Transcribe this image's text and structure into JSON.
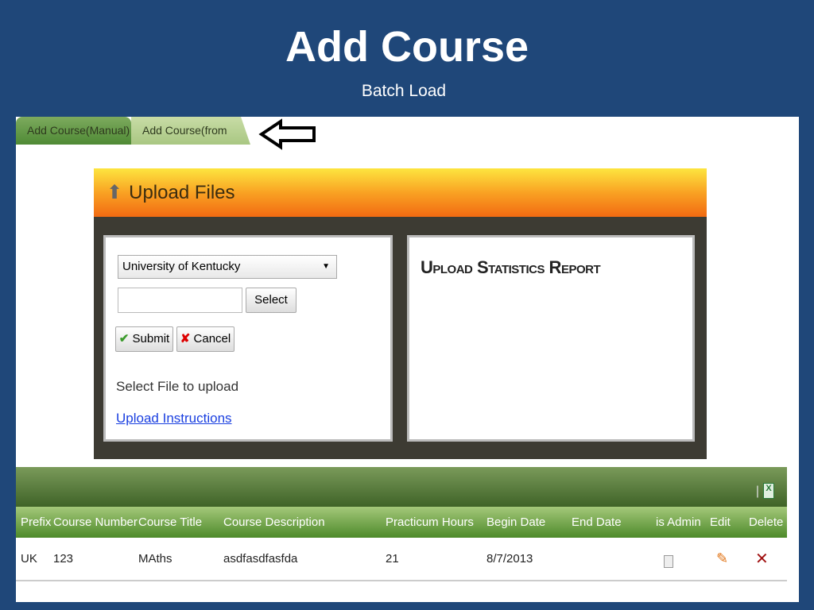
{
  "slide": {
    "title": "Add Course",
    "subtitle": "Batch Load"
  },
  "tabs": [
    {
      "label": "Add Course(Manual)"
    },
    {
      "label": "Add Course(from File)",
      "active": true
    }
  ],
  "upload": {
    "title": "Upload Files",
    "university": "University of Kentucky",
    "file_value": "",
    "select_label": "Select",
    "submit_label": "Submit",
    "cancel_label": "Cancel",
    "hint": "Select File to upload",
    "instructions_link": "Upload Instructions",
    "report_title": "Upload Statistics Report"
  },
  "table": {
    "columns": [
      "Prefix",
      "Course Number",
      "Course Title",
      "Course Description",
      "Practicum Hours",
      "Begin Date",
      "End Date",
      "is Admin",
      "Edit",
      "Delete"
    ],
    "rows": [
      [
        "UK",
        "123",
        "MAths",
        "asdfasdfasfda",
        "21",
        "8/7/2013",
        ""
      ]
    ]
  },
  "colors": {
    "slide_bg": "#1f4779",
    "header_orange": "#f9a223",
    "grid_green": "#4d8a2a"
  }
}
